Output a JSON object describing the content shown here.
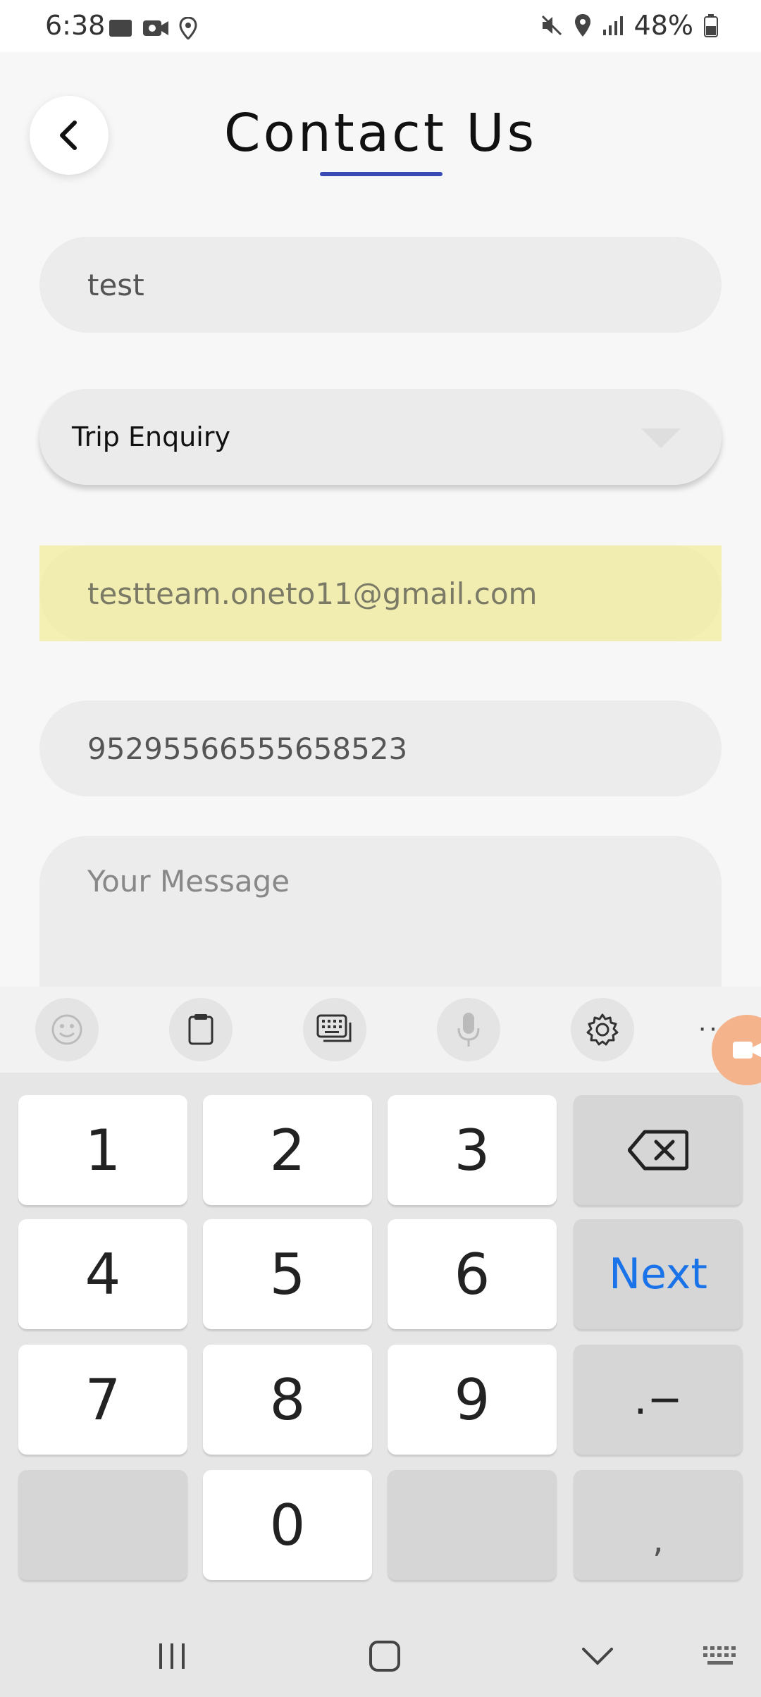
{
  "status_bar": {
    "time": "6:38",
    "battery": "48%"
  },
  "header": {
    "title": "Contact Us"
  },
  "form": {
    "name_value": "test",
    "subject_value": "Trip Enquiry",
    "email_value": "testteam.oneto11@gmail.com",
    "phone_value": "95295566555658523",
    "message_placeholder": "Your Message"
  },
  "keyboard": {
    "keys": {
      "k1": "1",
      "k2": "2",
      "k3": "3",
      "k4": "4",
      "k5": "5",
      "k6": "6",
      "k7": "7",
      "k8": "8",
      "k9": "9",
      "k0": "0",
      "next": "Next",
      "symbols": ".−",
      "comma": ","
    },
    "toolbar_more": "···"
  },
  "colors": {
    "accent_underline": "#3a4bb5",
    "next_key": "#1a73e8",
    "email_highlight": "#f4f0b3"
  }
}
